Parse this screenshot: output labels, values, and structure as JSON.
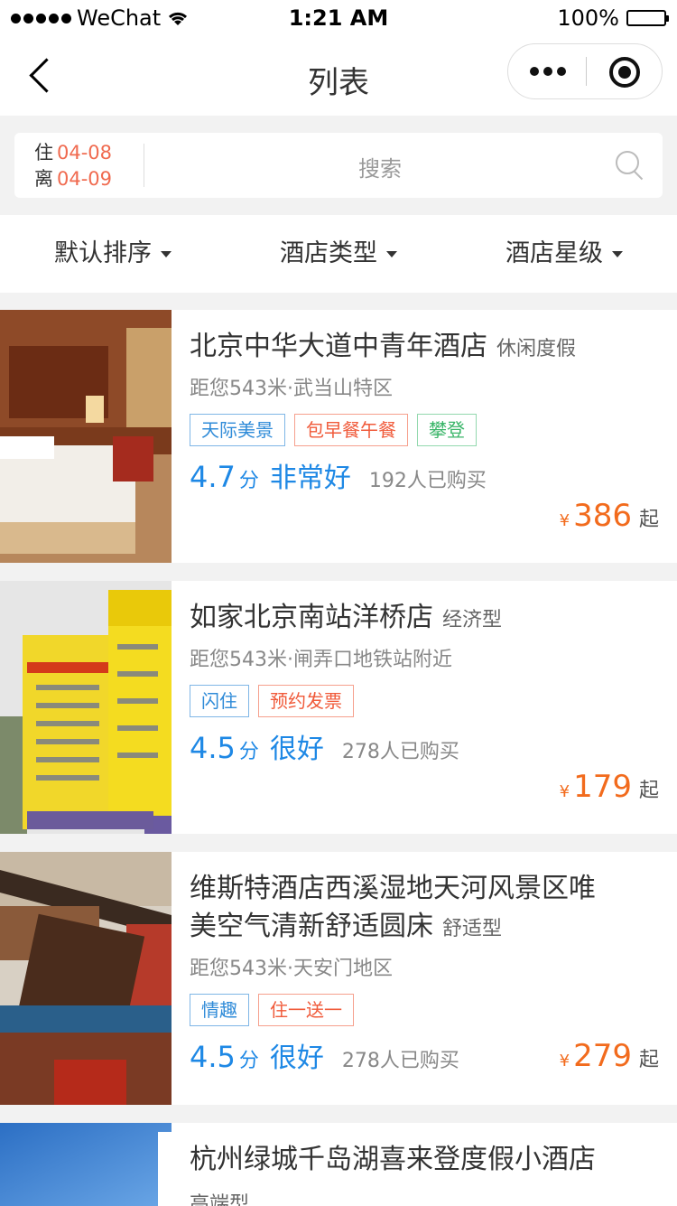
{
  "status_bar": {
    "carrier": "WeChat",
    "time": "1:21 AM",
    "battery": "100%"
  },
  "nav": {
    "title": "列表"
  },
  "search": {
    "checkin_label": "住",
    "checkin_date": "04-08",
    "checkout_label": "离",
    "checkout_date": "04-09",
    "placeholder": "搜索"
  },
  "filters": [
    {
      "label": "默认排序"
    },
    {
      "label": "酒店类型"
    },
    {
      "label": "酒店星级"
    }
  ],
  "hotels": [
    {
      "name": "北京中华大道中青年酒店",
      "type": "休闲度假",
      "distance": "距您543米·武当山特区",
      "tags": [
        "天际美景",
        "包早餐午餐",
        "攀登"
      ],
      "score": "4.7",
      "score_unit": "分",
      "rating_word": "非常好",
      "buyers": "192人已购买",
      "currency": "¥",
      "price": "386",
      "price_suffix": "起"
    },
    {
      "name": "如家北京南站洋桥店",
      "type": "经济型",
      "distance": "距您543米·闸弄口地铁站附近",
      "tags": [
        "闪住",
        "预约发票"
      ],
      "score": "4.5",
      "score_unit": "分",
      "rating_word": "很好",
      "buyers": "278人已购买",
      "currency": "¥",
      "price": "179",
      "price_suffix": "起"
    },
    {
      "name_line1": "维斯特酒店西溪湿地天河风景区唯",
      "name_line2": "美空气清新舒适圆床",
      "type": "舒适型",
      "distance": "距您543米·天安门地区",
      "tags": [
        "情趣",
        "住一送一"
      ],
      "score": "4.5",
      "score_unit": "分",
      "rating_word": "很好",
      "buyers": "278人已购买",
      "currency": "¥",
      "price": "279",
      "price_suffix": "起"
    },
    {
      "name": "杭州绿城千岛湖喜来登度假小酒店",
      "type": "高端型"
    }
  ],
  "colors": {
    "accent_blue": "#1e88e5",
    "price_orange": "#f26b1d",
    "date_red": "#f06a4f"
  }
}
